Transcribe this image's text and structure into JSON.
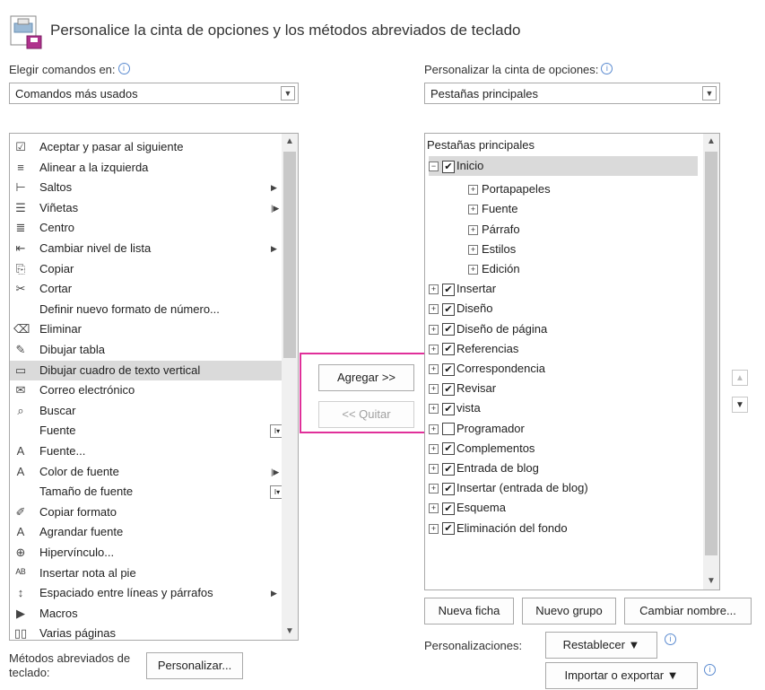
{
  "header": {
    "title": "Personalice la cinta de opciones y los métodos abreviados de teclado"
  },
  "left": {
    "label": "Elegir comandos en:",
    "combo_value": "Comandos más usados",
    "commands": [
      {
        "icon": "☑",
        "label": "Aceptar y pasar al siguiente",
        "sub": ""
      },
      {
        "icon": "≡",
        "label": "Alinear a la izquierda",
        "sub": ""
      },
      {
        "icon": "⊢",
        "label": "Saltos",
        "sub": "▶"
      },
      {
        "icon": "☰",
        "label": "Viñetas",
        "sub": "|▶"
      },
      {
        "icon": "≣",
        "label": "Centro",
        "sub": ""
      },
      {
        "icon": "⇤",
        "label": "Cambiar nivel de lista",
        "sub": "▶"
      },
      {
        "icon": "⎘",
        "label": "Copiar",
        "sub": ""
      },
      {
        "icon": "✂",
        "label": "Cortar",
        "sub": ""
      },
      {
        "icon": "",
        "label": "Definir nuevo formato de número...",
        "sub": ""
      },
      {
        "icon": "⌫",
        "label": "Eliminar",
        "sub": ""
      },
      {
        "icon": "✎",
        "label": "Dibujar tabla",
        "sub": ""
      },
      {
        "icon": "▭",
        "label": "Dibujar cuadro de texto vertical",
        "sub": ""
      },
      {
        "icon": "✉",
        "label": "Correo electrónico",
        "sub": ""
      },
      {
        "icon": "⌕",
        "label": "Buscar",
        "sub": ""
      },
      {
        "icon": "",
        "label": "Fuente",
        "sub": "I▾"
      },
      {
        "icon": "A",
        "label": "Fuente...",
        "sub": ""
      },
      {
        "icon": "A",
        "label": "Color de fuente",
        "sub": "|▶"
      },
      {
        "icon": "",
        "label": "Tamaño de fuente",
        "sub": "I▾"
      },
      {
        "icon": "✐",
        "label": "Copiar formato",
        "sub": ""
      },
      {
        "icon": "A",
        "label": "Agrandar fuente",
        "sub": ""
      },
      {
        "icon": "⊕",
        "label": "Hipervínculo...",
        "sub": ""
      },
      {
        "icon": "ᴬᴮ",
        "label": "Insertar nota al pie",
        "sub": ""
      },
      {
        "icon": "↕",
        "label": "Espaciado entre líneas y párrafos",
        "sub": "▶"
      },
      {
        "icon": "▶",
        "label": "Macros",
        "sub": ""
      },
      {
        "icon": "▯▯",
        "label": "Varias páginas",
        "sub": ""
      }
    ],
    "keyboard_label": "Métodos abreviados de teclado:",
    "customize_button": "Personalizar..."
  },
  "middle": {
    "add_button": "Agregar >>",
    "remove_button": "<< Quitar"
  },
  "right": {
    "label": "Personalizar la cinta de opciones:",
    "combo_value": "Pestañas principales",
    "tree_header": "Pestañas principales",
    "tabs": [
      {
        "label": "Inicio",
        "checked": true,
        "expanded": true,
        "groups": [
          "Portapapeles",
          "Fuente",
          "Párrafo",
          "Estilos",
          "Edición"
        ]
      },
      {
        "label": "Insertar",
        "checked": true
      },
      {
        "label": "Diseño",
        "checked": true
      },
      {
        "label": "Diseño de página",
        "checked": true
      },
      {
        "label": "Referencias",
        "checked": true
      },
      {
        "label": "Correspondencia",
        "checked": true
      },
      {
        "label": "Revisar",
        "checked": true
      },
      {
        "label": "vista",
        "checked": true
      },
      {
        "label": "Programador",
        "checked": false
      },
      {
        "label": "Complementos",
        "checked": true
      },
      {
        "label": "Entrada de blog",
        "checked": true
      },
      {
        "label": "Insertar (entrada de blog)",
        "checked": true
      },
      {
        "label": "Esquema",
        "checked": true
      },
      {
        "label": "Eliminación del fondo",
        "checked": true
      }
    ],
    "new_tab_button": "Nueva ficha",
    "new_group_button": "Nuevo grupo",
    "rename_button": "Cambiar nombre...",
    "customizations_label": "Personalizaciones:",
    "reset_button": "Restablecer ▼",
    "import_export_button": "Importar o exportar ▼"
  },
  "colors": {
    "highlight": "#e0309a",
    "info": "#5b8bd0",
    "selection": "#dadada"
  }
}
